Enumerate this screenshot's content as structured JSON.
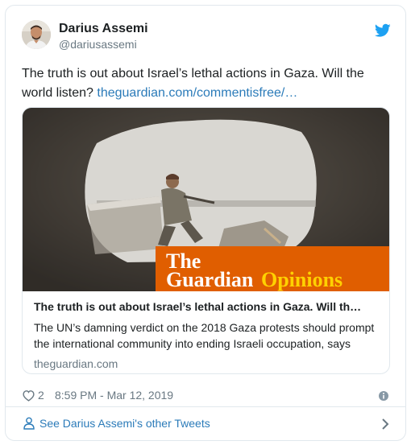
{
  "author": {
    "name": "Darius Assemi",
    "handle": "@dariusassemi"
  },
  "tweet": {
    "text": "The truth is out about Israel’s lethal actions in Gaza. Will the world listen? ",
    "link_text": "theguardian.com/commentisfree/…"
  },
  "card": {
    "brand_the": "The",
    "brand_guardian": "Guardian",
    "brand_opinions": "Opinions",
    "title": "The truth is out about Israel’s lethal actions in Gaza. Will th…",
    "description": "The UN’s damning verdict on the 2018 Gaza protests should prompt the international community into ending Israeli occupation, says",
    "domain": "theguardian.com"
  },
  "meta": {
    "likes": "2",
    "timestamp": "8:59 PM - Mar 12, 2019"
  },
  "footer": {
    "label": "See Darius Assemi's other Tweets"
  },
  "colors": {
    "link": "#2b7bb9",
    "twitter_blue": "#1da1f2",
    "guardian_orange": "#e05e00",
    "muted": "#697882",
    "border": "#e1e8ed"
  },
  "icons": [
    "twitter-bird-icon",
    "heart-icon",
    "info-icon",
    "person-icon",
    "chevron-right-icon"
  ]
}
